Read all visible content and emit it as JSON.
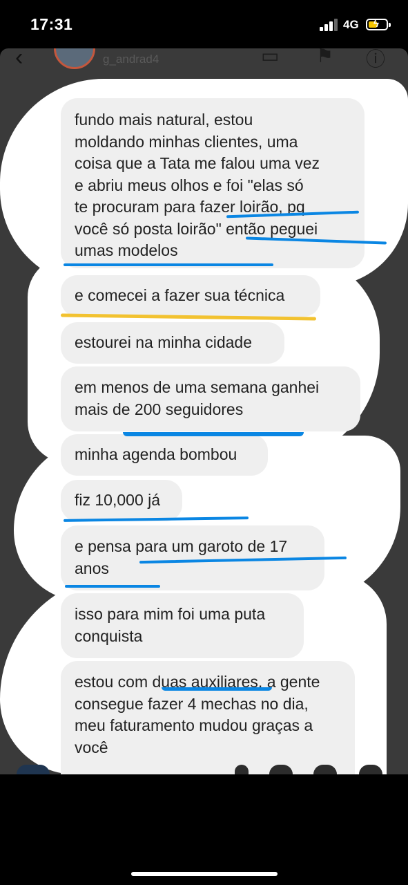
{
  "status_bar": {
    "time": "17:31",
    "network": "4G"
  },
  "header": {
    "username": "g_andrad4",
    "back_icon": "chevron-left-icon"
  },
  "messages": [
    {
      "text": "fundo mais natural, estou\nmoldando minhas clientes, uma\ncoisa que a Tata me falou uma vez\ne abriu meus olhos e foi \"elas só\nte procuram para fazer loirão, pq\nvocê só posta loirão\" então peguei\numas modelos"
    },
    {
      "text": "e comecei a fazer sua técnica"
    },
    {
      "text": "estourei na minha cidade"
    },
    {
      "text": "em menos de uma semana ganhei\nmais de 200 seguidores"
    },
    {
      "text": "minha agenda bombou"
    },
    {
      "text": "fiz 10,000 já"
    },
    {
      "text": "e pensa para um garoto de 17\nanos"
    },
    {
      "text": "isso para mim foi uma puta\nconquista"
    },
    {
      "text": "estou com duas auxiliares, a gente\nconsegue fazer 4 mechas no dia,\nmeu faturamento mudou graças a\nvocê"
    }
  ],
  "colors": {
    "bubble": "#efefef",
    "annotation_blue": "#0a86e3",
    "annotation_yellow": "#f2c230",
    "chat_bg": "#3a3a3a"
  }
}
